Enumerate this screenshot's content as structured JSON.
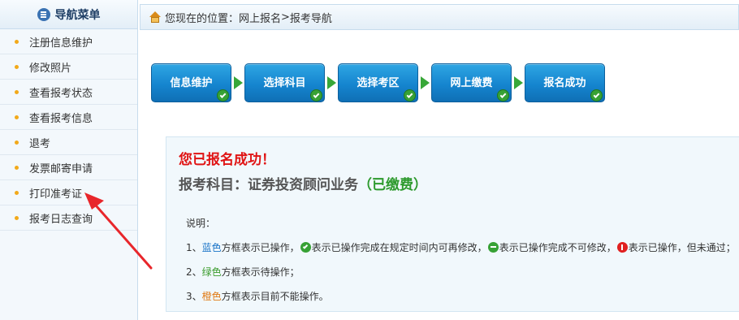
{
  "sidebar": {
    "title": "导航菜单",
    "items": [
      {
        "label": "注册信息维护"
      },
      {
        "label": "修改照片"
      },
      {
        "label": "查看报考状态"
      },
      {
        "label": "查看报考信息"
      },
      {
        "label": "退考"
      },
      {
        "label": "发票邮寄申请"
      },
      {
        "label": "打印准考证"
      },
      {
        "label": "报考日志查询"
      }
    ]
  },
  "header": {
    "location_label": "您现在的位置：网上报名",
    "separator": ">",
    "current": "报考导航"
  },
  "steps": [
    {
      "label": "信息维护"
    },
    {
      "label": "选择科目"
    },
    {
      "label": "选择考区"
    },
    {
      "label": "网上缴费"
    },
    {
      "label": "报名成功"
    }
  ],
  "result": {
    "success_text": "您已报名成功！",
    "subject_prefix": "报考科目：证券投资顾问业务",
    "paid_text": "（已缴费）"
  },
  "notes": {
    "title": "说明：",
    "line1_num": "1、",
    "line1_color_word": "蓝色",
    "line1_a": "方框表示已操作，",
    "line1_b": "表示已操作完成在规定时间内可再修改，",
    "line1_c": "表示已操作完成不可修改，",
    "line1_d": "表示已操作，但未通过；",
    "line2_num": "2、",
    "line2_color_word": "绿色",
    "line2_rest": "方框表示待操作；",
    "line3_num": "3、",
    "line3_color_word": "橙色",
    "line3_rest": "方框表示目前不能操作。"
  },
  "colors": {
    "step_blue": "#1585cf",
    "arrow_green": "#38a738",
    "success_red": "#e01414",
    "annotation_red": "#e8262b"
  }
}
